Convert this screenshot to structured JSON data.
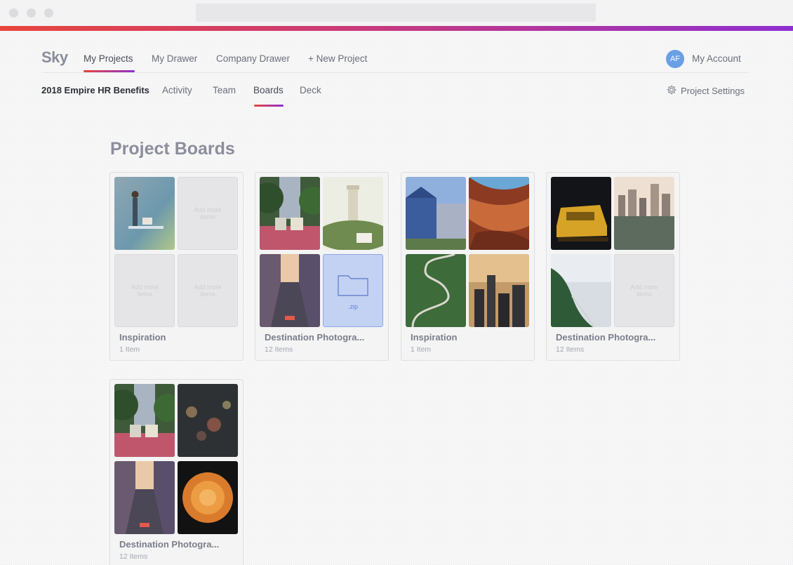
{
  "app": {
    "logo": "Sky"
  },
  "top_nav": {
    "items": [
      "My Projects",
      "My Drawer",
      "Company Drawer",
      "+ New Project"
    ],
    "active": "My Projects"
  },
  "account": {
    "initials": "AF",
    "label": "My Account",
    "avatar_color": "#6a9fe6"
  },
  "sub_nav": {
    "project_name": "2018 Empire HR Benefits",
    "tabs": [
      "Activity",
      "Team",
      "Boards",
      "Deck"
    ],
    "active": "Boards",
    "settings_label": "Project Settings"
  },
  "page": {
    "title": "Project Boards"
  },
  "empty_tile_text": "Add more items",
  "zip_label": ".zip",
  "boards": [
    {
      "title": "Inspiration",
      "count": "1 Item",
      "tiles": [
        "paddleboard-photo",
        "empty",
        "empty",
        "empty"
      ]
    },
    {
      "title": "Destination Photogra...",
      "count": "12 Items",
      "tiles": [
        "cable-car-photo",
        "coit-tower-photo",
        "city-street-photo",
        "zip-file"
      ]
    },
    {
      "title": "Inspiration",
      "count": "1 Item",
      "tiles": [
        "painted-ladies-photo",
        "antelope-canyon-photo",
        "winding-road-photo",
        "skyline-sunset-photo"
      ]
    },
    {
      "title": "Destination Photogra...",
      "count": "12 Items",
      "tiles": [
        "yellow-car-photo",
        "city-reflection-photo",
        "coastline-photo",
        "empty"
      ]
    },
    {
      "title": "Destination Photogra...",
      "count": "12 Items",
      "tiles": [
        "cable-car-photo",
        "bokeh-lights-photo",
        "city-street-photo",
        "dahlia-flower-photo"
      ]
    }
  ],
  "colors": {
    "accent_start": "#e8453c",
    "accent_end": "#8e2fd0"
  }
}
